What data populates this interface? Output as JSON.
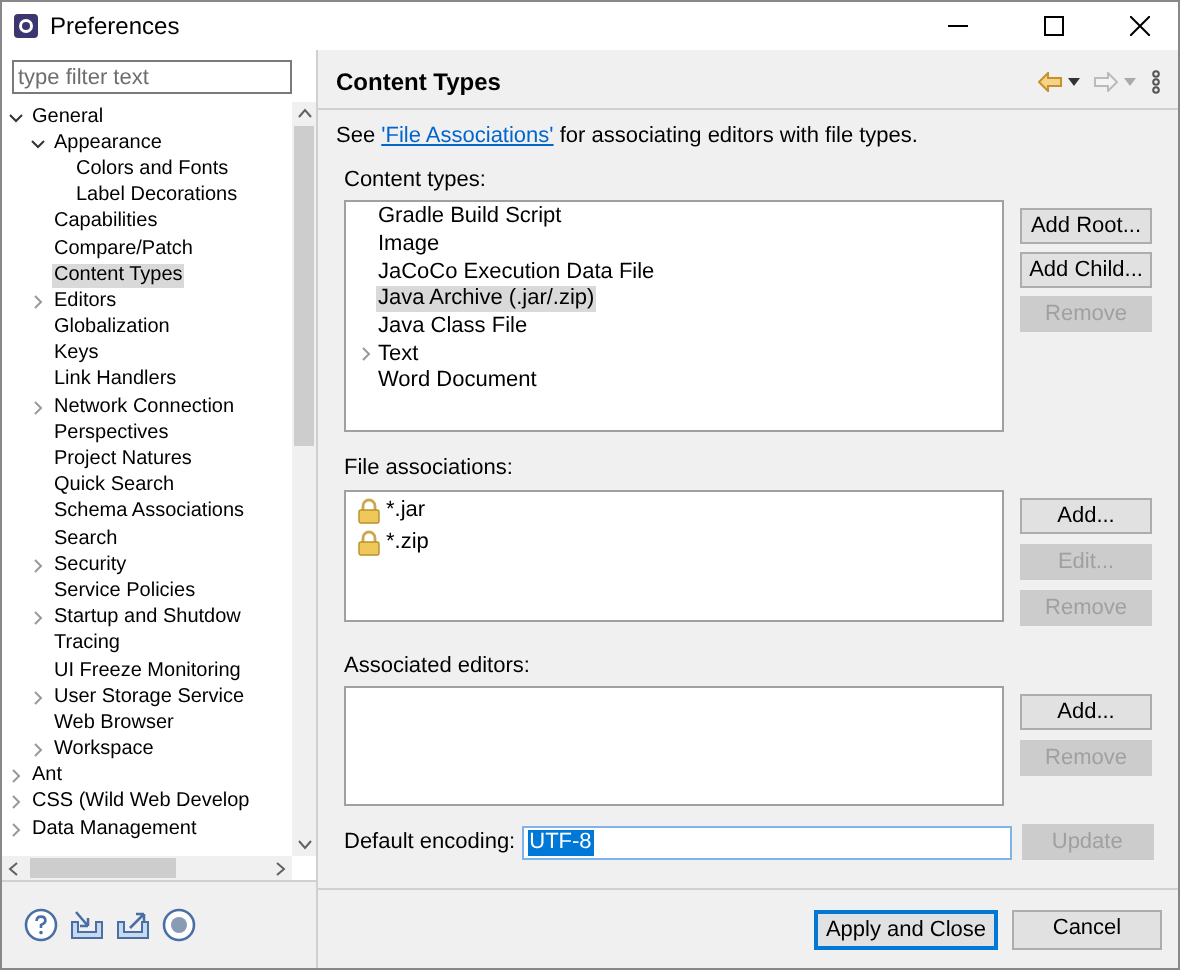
{
  "window": {
    "title": "Preferences"
  },
  "filter": {
    "placeholder": "type filter text"
  },
  "tree": [
    {
      "label": "General",
      "selected": false,
      "expanded": true,
      "children": [
        {
          "label": "Appearance",
          "selected": false,
          "expanded": true,
          "children": [
            {
              "label": "Colors and Fonts",
              "selected": false
            },
            {
              "label": "Label Decorations",
              "selected": false
            }
          ]
        },
        {
          "label": "Capabilities",
          "selected": false
        },
        {
          "label": "Compare/Patch",
          "selected": false
        },
        {
          "label": "Content Types",
          "selected": true
        },
        {
          "label": "Editors",
          "selected": false,
          "expanded": false
        },
        {
          "label": "Globalization",
          "selected": false
        },
        {
          "label": "Keys",
          "selected": false
        },
        {
          "label": "Link Handlers",
          "selected": false
        },
        {
          "label": "Network Connection",
          "selected": false,
          "expanded": false
        },
        {
          "label": "Perspectives",
          "selected": false
        },
        {
          "label": "Project Natures",
          "selected": false
        },
        {
          "label": "Quick Search",
          "selected": false
        },
        {
          "label": "Schema Associations",
          "selected": false
        },
        {
          "label": "Search",
          "selected": false
        },
        {
          "label": "Security",
          "selected": false,
          "expanded": false
        },
        {
          "label": "Service Policies",
          "selected": false
        },
        {
          "label": "Startup and Shutdow",
          "selected": false,
          "expanded": false
        },
        {
          "label": "Tracing",
          "selected": false
        },
        {
          "label": "UI Freeze Monitoring",
          "selected": false
        },
        {
          "label": "User Storage Service",
          "selected": false,
          "expanded": false
        },
        {
          "label": "Web Browser",
          "selected": false
        },
        {
          "label": "Workspace",
          "selected": false,
          "expanded": false
        }
      ]
    },
    {
      "label": "Ant",
      "selected": false,
      "expanded": false
    },
    {
      "label": "CSS (Wild Web Develop",
      "selected": false,
      "expanded": false
    },
    {
      "label": "Data Management",
      "selected": false,
      "expanded": false
    }
  ],
  "page": {
    "title": "Content Types",
    "intro": {
      "before": "See ",
      "link": "'File Associations'",
      "after": " for associating editors with file types."
    },
    "content_types": {
      "label": "Content types:",
      "items": [
        {
          "label": "Gradle Build Script",
          "selected": false
        },
        {
          "label": "Image",
          "selected": false
        },
        {
          "label": "JaCoCo Execution Data File",
          "selected": false
        },
        {
          "label": "Java Archive (.jar/.zip)",
          "selected": true
        },
        {
          "label": "Java Class File",
          "selected": false
        },
        {
          "label": "Text",
          "selected": false,
          "expanded": false
        },
        {
          "label": "Word Document",
          "selected": false
        }
      ],
      "buttons": [
        {
          "label": "Add Root...",
          "disabled": false
        },
        {
          "label": "Add Child...",
          "disabled": false
        },
        {
          "label": "Remove",
          "disabled": true
        }
      ]
    },
    "file_associations": {
      "label": "File associations:",
      "items": [
        {
          "label": "*.jar",
          "selected": false
        },
        {
          "label": "*.zip",
          "selected": false
        }
      ],
      "buttons": [
        {
          "label": "Add...",
          "disabled": false
        },
        {
          "label": "Edit...",
          "disabled": true
        },
        {
          "label": "Remove",
          "disabled": true
        }
      ]
    },
    "associated_editors": {
      "label": "Associated editors:",
      "buttons": [
        {
          "label": "Add...",
          "disabled": false
        },
        {
          "label": "Remove",
          "disabled": true
        }
      ]
    },
    "encoding": {
      "label": "Default encoding:",
      "value": "UTF-8",
      "update": {
        "label": "Update",
        "disabled": true
      }
    }
  },
  "footer": {
    "buttons": [
      {
        "label": "Apply and Close",
        "default": true
      },
      {
        "label": "Cancel",
        "default": false
      }
    ]
  }
}
